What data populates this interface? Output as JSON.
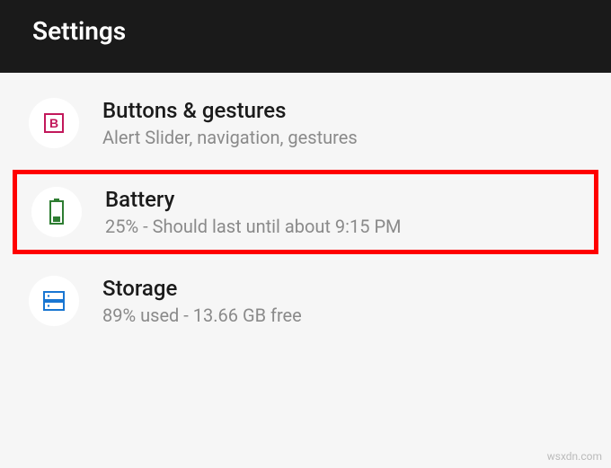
{
  "header": {
    "title": "Settings"
  },
  "items": [
    {
      "title": "Buttons & gestures",
      "subtitle": "Alert Slider, navigation, gestures"
    },
    {
      "title": "Battery",
      "subtitle": "25% - Should last until about 9:15 PM"
    },
    {
      "title": "Storage",
      "subtitle": "89% used - 13.66 GB free"
    }
  ],
  "watermark": "wsxdn.com",
  "colors": {
    "buttons_icon": "#c2185b",
    "battery_icon": "#2e7d32",
    "storage_icon": "#1976d2",
    "highlight": "#ff0000"
  }
}
